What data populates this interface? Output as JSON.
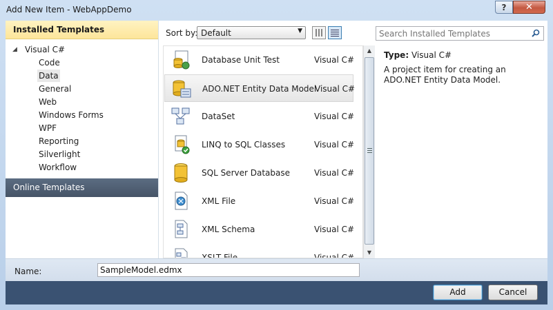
{
  "window": {
    "title": "Add New Item - WebAppDemo",
    "help_label": "?",
    "close_label": "✕"
  },
  "left": {
    "installed_header": "Installed Templates",
    "tree_root": "Visual C#",
    "tree_items": [
      "Code",
      "Data",
      "General",
      "Web",
      "Windows Forms",
      "WPF",
      "Reporting",
      "Silverlight",
      "Workflow"
    ],
    "selected_item": "Data",
    "online_header": "Online Templates"
  },
  "toolbar": {
    "sort_by_label": "Sort by:",
    "sort_value": "Default",
    "search_placeholder": "Search Installed Templates"
  },
  "templates": [
    {
      "name": "Database Unit Test",
      "lang": "Visual C#",
      "icon": "database-unit-test-icon"
    },
    {
      "name": "ADO.NET Entity Data Model",
      "lang": "Visual C#",
      "icon": "entity-data-model-icon",
      "selected": true
    },
    {
      "name": "DataSet",
      "lang": "Visual C#",
      "icon": "dataset-icon"
    },
    {
      "name": "LINQ to SQL Classes",
      "lang": "Visual C#",
      "icon": "linq-to-sql-icon"
    },
    {
      "name": "SQL Server Database",
      "lang": "Visual C#",
      "icon": "sql-database-icon"
    },
    {
      "name": "XML File",
      "lang": "Visual C#",
      "icon": "xml-file-icon"
    },
    {
      "name": "XML Schema",
      "lang": "Visual C#",
      "icon": "xml-schema-icon"
    },
    {
      "name": "XSLT File",
      "lang": "Visual C#",
      "icon": "xslt-file-icon"
    }
  ],
  "details": {
    "type_label": "Type:",
    "type_value": "Visual C#",
    "description": "A project item for creating an ADO.NET Entity Data Model."
  },
  "bottom": {
    "name_label": "Name:",
    "name_value": "SampleModel.edmx",
    "add_label": "Add",
    "cancel_label": "Cancel"
  }
}
